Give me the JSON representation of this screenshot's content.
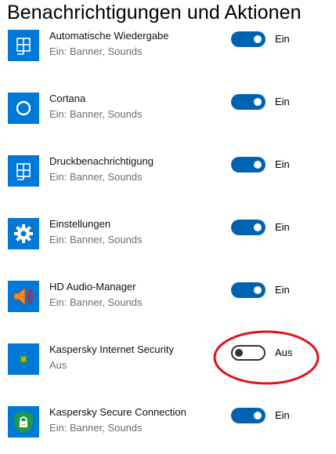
{
  "page": {
    "title": "Benachrichtigungen und Aktionen"
  },
  "colors": {
    "accent": "#0063b1",
    "tile": "#0078d7",
    "annotation": "#e0121b"
  },
  "apps": [
    {
      "name": "Automatische Wiedergabe",
      "sub": "Ein: Banner, Sounds",
      "toggle": "Ein",
      "on": true,
      "icon": "autoplay-icon"
    },
    {
      "name": "Cortana",
      "sub": "Ein: Banner, Sounds",
      "toggle": "Ein",
      "on": true,
      "icon": "cortana-icon"
    },
    {
      "name": "Druckbenachrichtigung",
      "sub": "Ein: Banner, Sounds",
      "toggle": "Ein",
      "on": true,
      "icon": "print-notification-icon"
    },
    {
      "name": "Einstellungen",
      "sub": "Ein: Banner, Sounds",
      "toggle": "Ein",
      "on": true,
      "icon": "gear-icon"
    },
    {
      "name": "HD Audio-Manager",
      "sub": "Ein: Banner, Sounds",
      "toggle": "Ein",
      "on": true,
      "icon": "speaker-icon"
    },
    {
      "name": "Kaspersky Internet Security",
      "sub": "Aus",
      "toggle": "Aus",
      "on": false,
      "icon": "kaspersky-icon"
    },
    {
      "name": "Kaspersky Secure Connection",
      "sub": "Ein: Banner, Sounds",
      "toggle": "Ein",
      "on": true,
      "icon": "kaspersky-vpn-icon"
    }
  ]
}
